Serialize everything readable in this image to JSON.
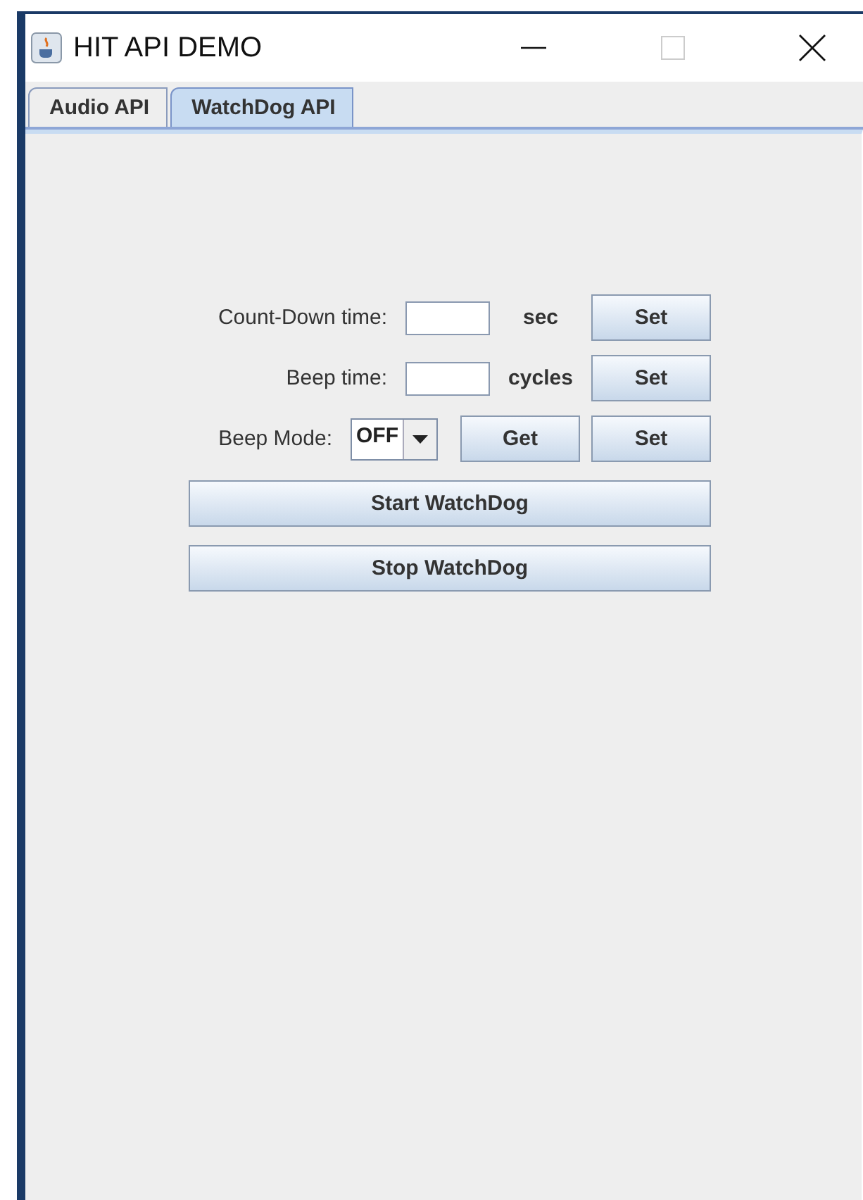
{
  "window": {
    "title": "HIT API DEMO"
  },
  "tabs": [
    {
      "label": "Audio API",
      "selected": false
    },
    {
      "label": "WatchDog API",
      "selected": true
    }
  ],
  "form": [
    {
      "kind": "field",
      "label": "Count-Down time:",
      "unit": "sec",
      "button": "Set"
    },
    {
      "kind": "field",
      "label": "Beep time:",
      "unit": "cycles",
      "button": "Set"
    },
    {
      "kind": "combo",
      "label": "Beep Mode:",
      "value": "OFF",
      "get_button": "Get",
      "button": "Set"
    }
  ],
  "actions": [
    "Start WatchDog",
    "Stop WatchDog"
  ]
}
